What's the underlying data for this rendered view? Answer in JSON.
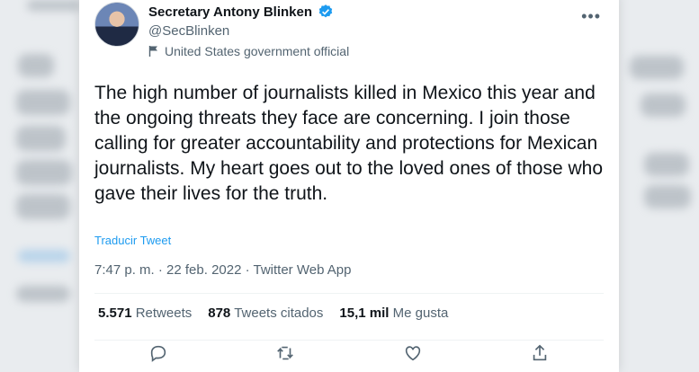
{
  "user": {
    "display_name": "Secretary Antony Blinken",
    "handle": "@SecBlinken",
    "label": "United States government official"
  },
  "tweet": {
    "text": "The high number of journalists killed in Mexico this year and the ongoing threats they face are concerning. I join those calling for greater accountability and protections for Mexican journalists. My heart goes out to the loved ones of those who gave their lives for the truth.",
    "translate_link": "Traducir Tweet",
    "timestamp": "7:47 p. m. · 22 feb. 2022 · Twitter Web App"
  },
  "stats": [
    {
      "count": "5.571",
      "label": "Retweets"
    },
    {
      "count": "878",
      "label": "Tweets citados"
    },
    {
      "count": "15,1 mil",
      "label": "Me gusta"
    }
  ],
  "colors": {
    "accent": "#1d9bf0",
    "text": "#0f1419",
    "muted": "#536471"
  },
  "icons": [
    "verified-badge-icon",
    "flag-icon",
    "more-options-icon",
    "reply-icon",
    "retweet-icon",
    "like-icon",
    "share-icon"
  ]
}
